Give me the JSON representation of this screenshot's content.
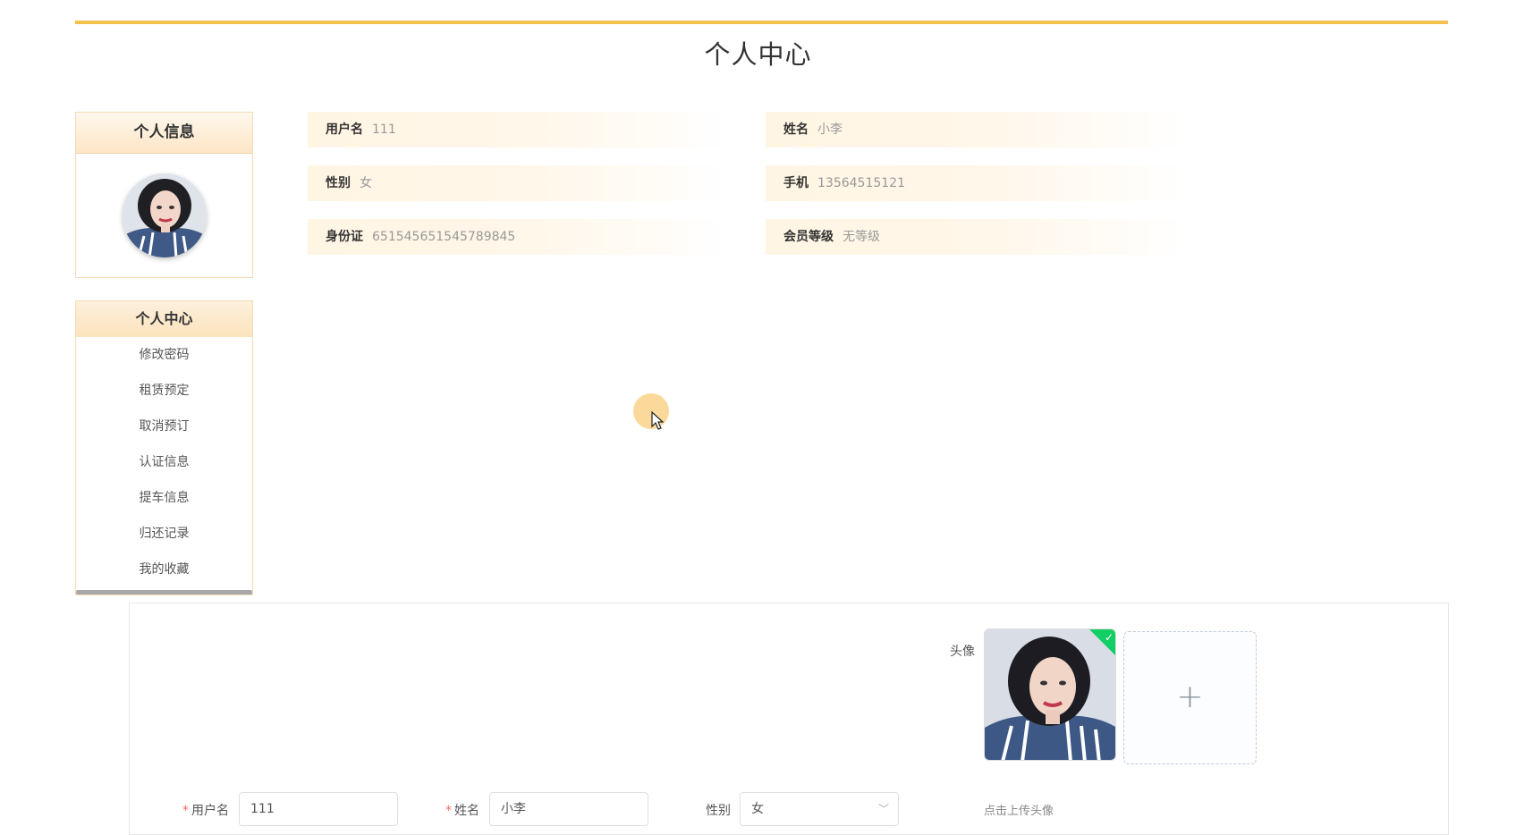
{
  "page": {
    "title": "个人中心"
  },
  "profile_card": {
    "title": "个人信息"
  },
  "menu": {
    "title": "个人中心",
    "items": [
      "修改密码",
      "租赁预定",
      "取消预订",
      "认证信息",
      "提车信息",
      "归还记录",
      "我的收藏"
    ]
  },
  "info": {
    "username_label": "用户名",
    "username": "111",
    "name_label": "姓名",
    "name": "小李",
    "gender_label": "性别",
    "gender": "女",
    "phone_label": "手机",
    "phone": "13564515121",
    "idcard_label": "身份证",
    "idcard": "651545651545789845",
    "level_label": "会员等级",
    "level": "无等级"
  },
  "form": {
    "avatar_label": "头像",
    "upload_tip": "点击上传头像",
    "username_label": "用户名",
    "username_value": "111",
    "name_label": "姓名",
    "name_value": "小李",
    "gender_label": "性别",
    "gender_value": "女"
  },
  "colors": {
    "accent": "#f2c14e",
    "header_bg": "#fde6c6",
    "required": "#f56c6c",
    "success": "#13ce66"
  }
}
